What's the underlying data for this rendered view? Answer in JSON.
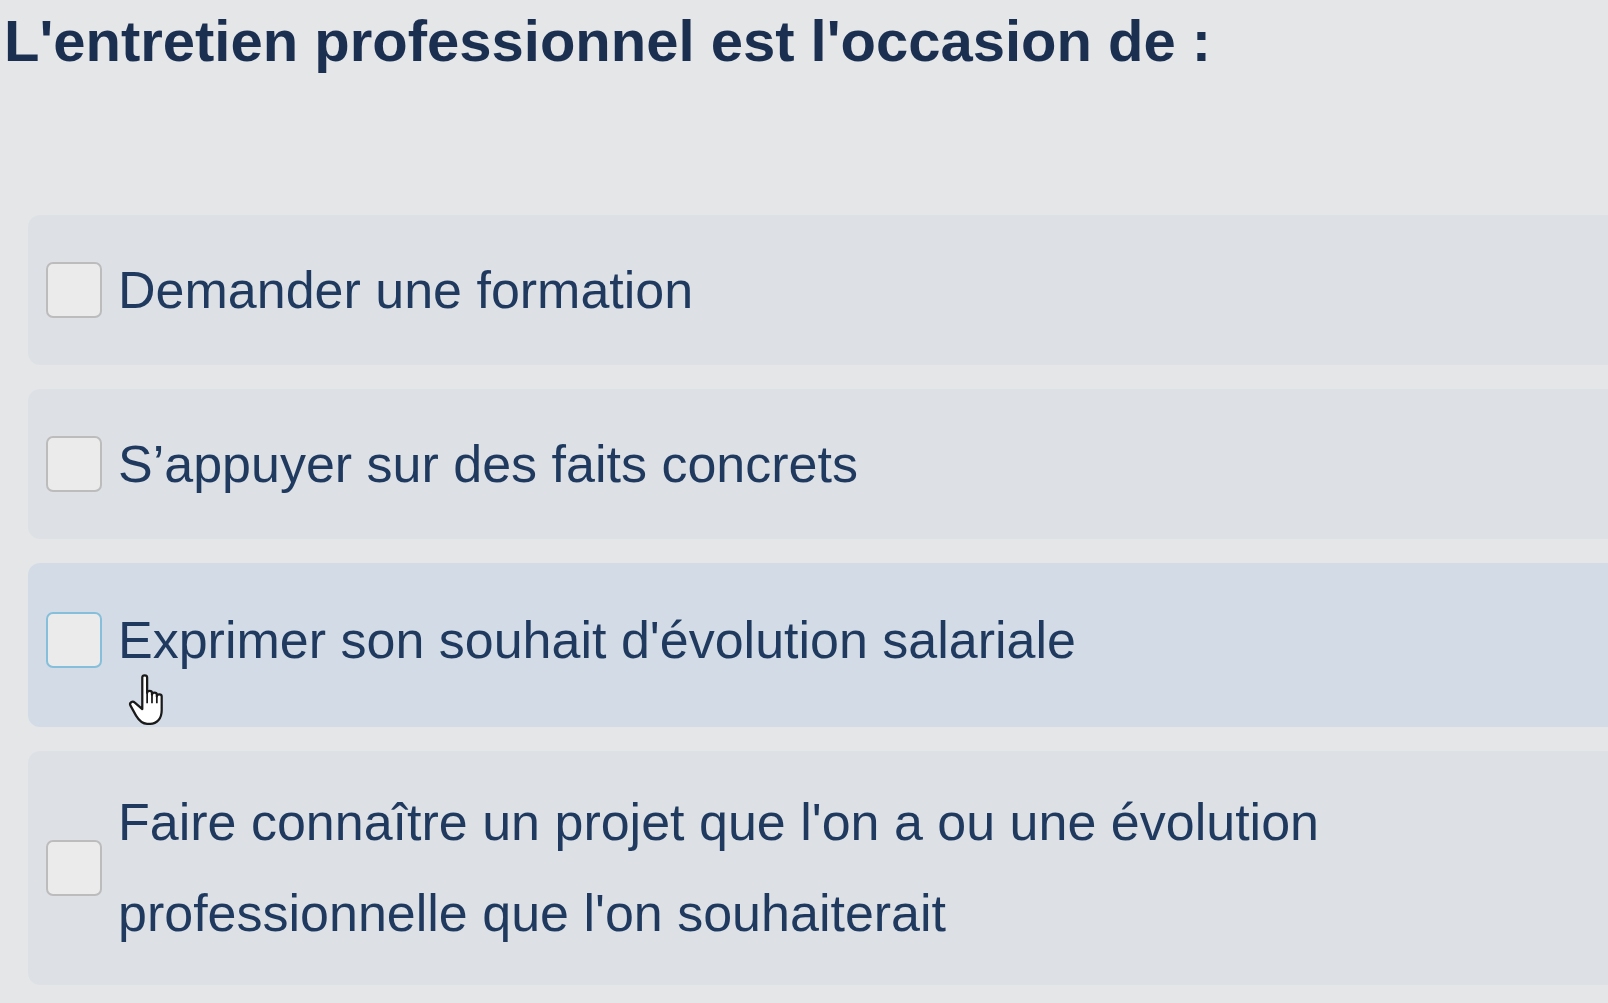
{
  "question": {
    "title": "L'entretien professionnel est l'occasion de :"
  },
  "options": [
    {
      "label": "Demander une formation",
      "checked": false,
      "hovered": false
    },
    {
      "label": "S’appuyer sur des faits concrets",
      "checked": false,
      "hovered": false
    },
    {
      "label": "Exprimer son souhait d'évolution salariale",
      "checked": false,
      "hovered": true
    },
    {
      "label": "Faire connaître un projet que l'on a ou une évolution professionnelle que l'on souhaiterait",
      "checked": false,
      "hovered": false
    }
  ]
}
